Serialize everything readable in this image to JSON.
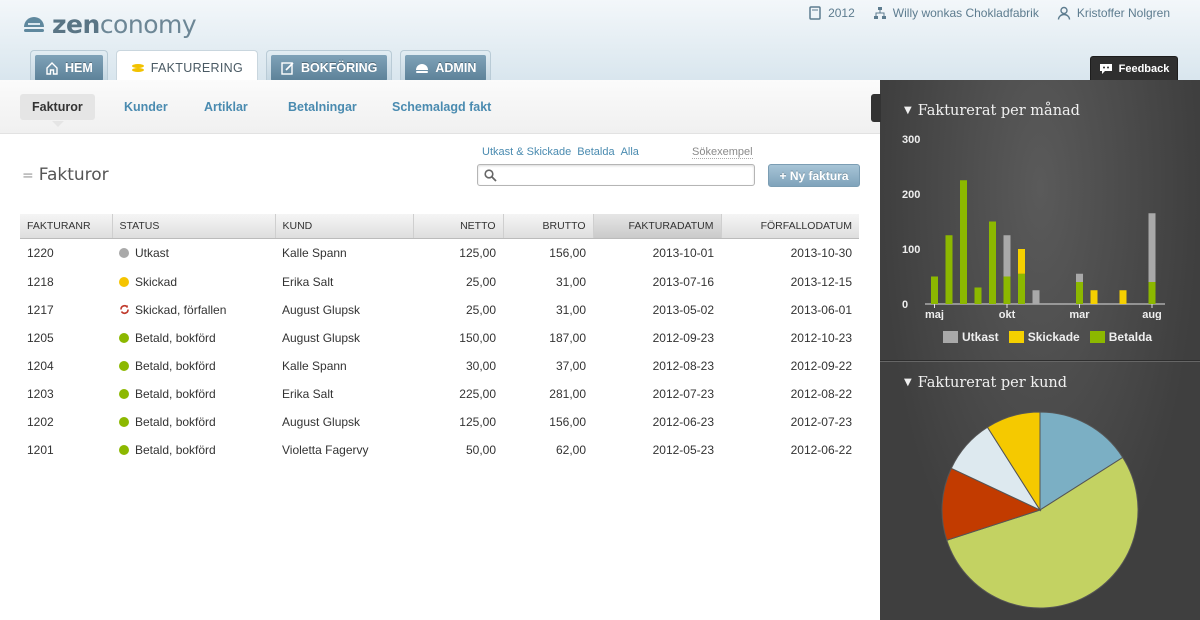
{
  "app": {
    "logo_bold": "zen",
    "logo_rest": "conomy"
  },
  "topbar": {
    "year": "2012",
    "company": "Willy wonkas Chokladfabrik",
    "user": "Kristoffer Nolgren"
  },
  "tabs": [
    {
      "label": "HEM"
    },
    {
      "label": "FAKTURERING"
    },
    {
      "label": "BOKFÖRING"
    },
    {
      "label": "ADMIN"
    }
  ],
  "feedback": "Feedback",
  "subnav": [
    {
      "label": "Fakturor"
    },
    {
      "label": "Kunder"
    },
    {
      "label": "Artiklar"
    },
    {
      "label": "Betalningar"
    },
    {
      "label": "Schemalagd fakt"
    }
  ],
  "page": {
    "title": "Fakturor",
    "eq": "="
  },
  "filters": {
    "a": "Utkast & Skickade",
    "b": "Betalda",
    "c": "Alla"
  },
  "search": {
    "hint": "Sökexempel",
    "placeholder": ""
  },
  "new_invoice": "+ Ny faktura",
  "table": {
    "headers": [
      "FAKTURANR",
      "STATUS",
      "KUND",
      "NETTO",
      "BRUTTO",
      "FAKTURADATUM",
      "FÖRFALLODATUM"
    ],
    "rows": [
      {
        "nr": "1220",
        "status": "Utkast",
        "kind": "draft",
        "kund": "Kalle Spann",
        "netto": "125,00",
        "brutto": "156,00",
        "datum": "2013-10-01",
        "forfall": "2013-10-30"
      },
      {
        "nr": "1218",
        "status": "Skickad",
        "kind": "sent",
        "kund": "Erika Salt",
        "netto": "25,00",
        "brutto": "31,00",
        "datum": "2013-07-16",
        "forfall": "2013-12-15"
      },
      {
        "nr": "1217",
        "status": "Skickad, förfallen",
        "kind": "overdue",
        "kund": "August Glupsk",
        "netto": "25,00",
        "brutto": "31,00",
        "datum": "2013-05-02",
        "forfall": "2013-06-01"
      },
      {
        "nr": "1205",
        "status": "Betald, bokförd",
        "kind": "paid",
        "kund": "August Glupsk",
        "netto": "150,00",
        "brutto": "187,00",
        "datum": "2012-09-23",
        "forfall": "2012-10-23"
      },
      {
        "nr": "1204",
        "status": "Betald, bokförd",
        "kind": "paid",
        "kund": "Kalle Spann",
        "netto": "30,00",
        "brutto": "37,00",
        "datum": "2012-08-23",
        "forfall": "2012-09-22"
      },
      {
        "nr": "1203",
        "status": "Betald, bokförd",
        "kind": "paid",
        "kund": "Erika Salt",
        "netto": "225,00",
        "brutto": "281,00",
        "datum": "2012-07-23",
        "forfall": "2012-08-22"
      },
      {
        "nr": "1202",
        "status": "Betald, bokförd",
        "kind": "paid",
        "kund": "August Glupsk",
        "netto": "125,00",
        "brutto": "156,00",
        "datum": "2012-06-23",
        "forfall": "2012-07-23"
      },
      {
        "nr": "1201",
        "status": "Betald, bokförd",
        "kind": "paid",
        "kund": "Violetta Fagervy",
        "netto": "50,00",
        "brutto": "62,00",
        "datum": "2012-05-23",
        "forfall": "2012-06-22"
      }
    ]
  },
  "colors": {
    "draft": "#a9a9a9",
    "sent": "#f5c400",
    "paid": "#8cb800",
    "overdue": "#c0392b",
    "accent": "#4a8bb0"
  },
  "chart_data": [
    {
      "type": "bar",
      "title": "Fakturerat per månad",
      "stacked": true,
      "ylim": [
        0,
        300
      ],
      "yticks": [
        0,
        100,
        200,
        300
      ],
      "xtick_labels": [
        {
          "label": "maj",
          "index": 0
        },
        {
          "label": "okt",
          "index": 5
        },
        {
          "label": "mar",
          "index": 10
        },
        {
          "label": "aug",
          "index": 15
        }
      ],
      "series": [
        {
          "name": "Utkast",
          "color": "#a9a9a9",
          "values": [
            0,
            0,
            0,
            0,
            0,
            0,
            0,
            0,
            0,
            0,
            0,
            0,
            0,
            0,
            0,
            0,
            0,
            0,
            0,
            0,
            0,
            0,
            0,
            0,
            0,
            0,
            0,
            0,
            0,
            0,
            0,
            125,
            0,
            0,
            0,
            0,
            0,
            0,
            0,
            0,
            0,
            0,
            0,
            0,
            0,
            0,
            0,
            0,
            0,
            0,
            0,
            0,
            0,
            0,
            0,
            0,
            0,
            0,
            0,
            0,
            0,
            0,
            0,
            0,
            0,
            0,
            0,
            0,
            0,
            0,
            0,
            0,
            0,
            0,
            0,
            0,
            0,
            0,
            0,
            0,
            0,
            0,
            0,
            0,
            0,
            0,
            0,
            0,
            0,
            0,
            0,
            0,
            0,
            0,
            0,
            0,
            0,
            0,
            0,
            0
          ]
        }
      ],
      "bars": [
        {
          "Betalda": 50,
          "Skickade": 0,
          "Utkast": 0
        },
        {
          "Betalda": 125,
          "Skickade": 0,
          "Utkast": 0
        },
        {
          "Betalda": 225,
          "Skickade": 0,
          "Utkast": 0
        },
        {
          "Betalda": 30,
          "Skickade": 0,
          "Utkast": 0
        },
        {
          "Betalda": 150,
          "Skickade": 0,
          "Utkast": 0
        },
        {
          "Betalda": 50,
          "Skickade": 0,
          "Utkast": 75
        },
        {
          "Betalda": 55,
          "Skickade": 45,
          "Utkast": 0
        },
        {
          "Betalda": 0,
          "Skickade": 0,
          "Utkast": 25
        },
        {
          "Betalda": 0,
          "Skickade": 0,
          "Utkast": 0
        },
        {
          "Betalda": 0,
          "Skickade": 0,
          "Utkast": 0
        },
        {
          "Betalda": 40,
          "Skickade": 0,
          "Utkast": 15
        },
        {
          "Betalda": 0,
          "Skickade": 25,
          "Utkast": 0
        },
        {
          "Betalda": 0,
          "Skickade": 0,
          "Utkast": 0
        },
        {
          "Betalda": 0,
          "Skickade": 25,
          "Utkast": 0
        },
        {
          "Betalda": 0,
          "Skickade": 0,
          "Utkast": 0
        },
        {
          "Betalda": 40,
          "Skickade": 0,
          "Utkast": 125
        }
      ],
      "legend": [
        {
          "name": "Utkast",
          "color": "#a9a9a9"
        },
        {
          "name": "Skickade",
          "color": "#f5d000"
        },
        {
          "name": "Betalda",
          "color": "#8cb800"
        }
      ]
    },
    {
      "type": "pie",
      "title": "Fakturerat per kund",
      "slices": [
        {
          "value": 16,
          "color": "#7bafc4"
        },
        {
          "value": 54,
          "color": "#c3d262"
        },
        {
          "value": 12,
          "color": "#c23b00"
        },
        {
          "value": 9,
          "color": "#dde9ef"
        },
        {
          "value": 9,
          "color": "#f5c900"
        }
      ]
    }
  ]
}
